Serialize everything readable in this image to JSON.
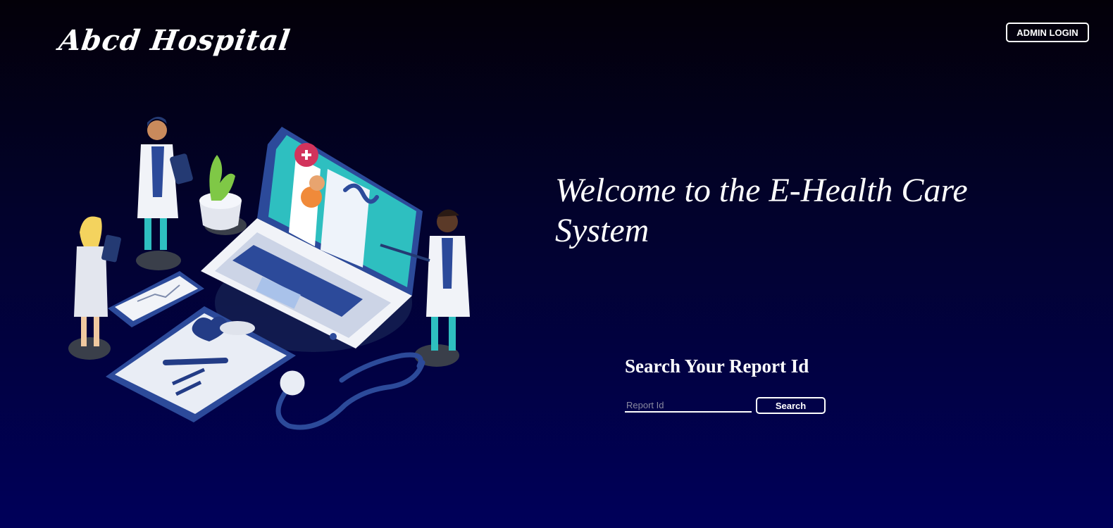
{
  "header": {
    "brand": "Abcd Hospital",
    "admin_login_label": "ADMIN LOGIN"
  },
  "hero": {
    "welcome_text": "Welcome to the E-Health Care System",
    "illustration": "medical-team-laptop-illustration"
  },
  "search": {
    "title": "Search Your Report Id",
    "input_placeholder": "Report Id",
    "input_value": "",
    "button_label": "Search"
  },
  "colors": {
    "background_top": "#030008",
    "background_bottom": "#00005a",
    "text": "#ffffff",
    "illustration_primary": "#2b4ea0",
    "illustration_accent": "#2ebfc0"
  }
}
